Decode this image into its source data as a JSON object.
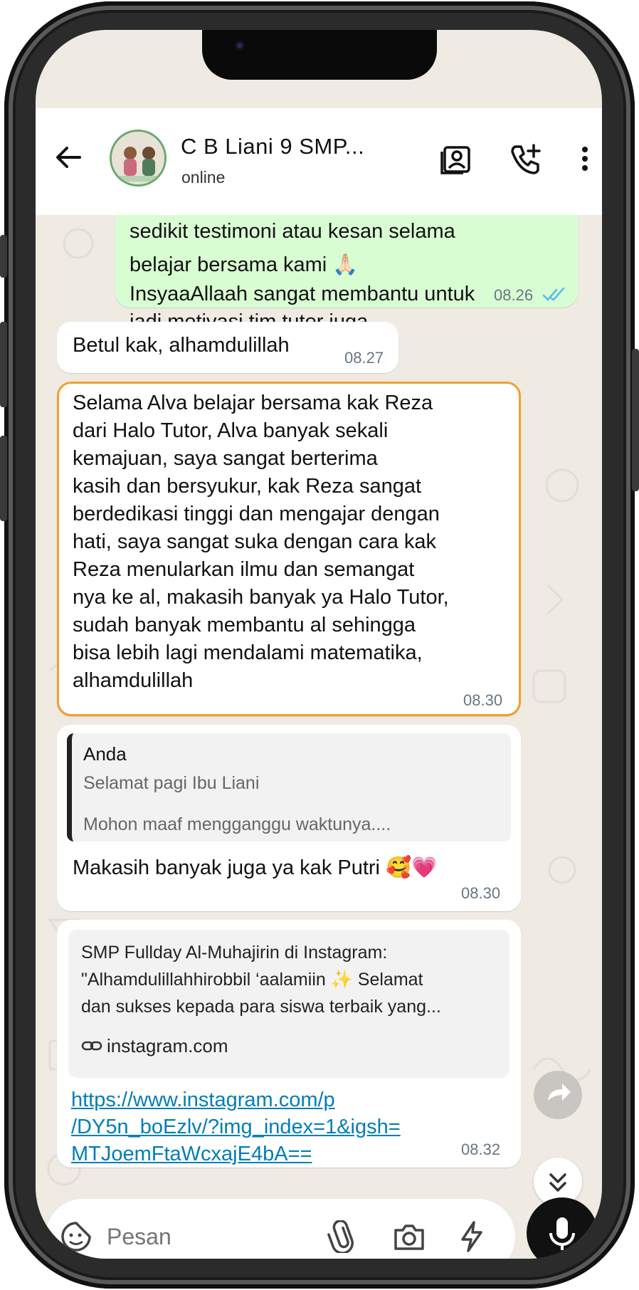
{
  "header": {
    "title": "C B Liani 9 SMP...",
    "status": "online"
  },
  "messages": {
    "m1": {
      "lines": [
        "sedikit testimoni atau kesan selama",
        "belajar bersama kami 🙏🏻",
        "InsyaaAllaah sangat membantu untuk",
        "jadi motivasi tim tutor juga"
      ],
      "time": "08.26"
    },
    "m2": {
      "text": "Betul kak, alhamdulillah",
      "time": "08.27"
    },
    "m3": {
      "lines": [
        "Selama Alva belajar bersama kak Reza",
        "dari Halo Tutor, Alva banyak sekali",
        "kemajuan, saya sangat berterima",
        "kasih dan bersyukur, kak Reza sangat",
        "berdedikasi tinggi dan mengajar dengan",
        "hati, saya sangat suka dengan cara kak",
        "Reza menularkan ilmu dan semangat",
        "nya ke al, makasih banyak ya Halo Tutor,",
        "sudah banyak membantu al sehingga",
        "bisa lebih lagi mendalami matematika,",
        "alhamdulillah"
      ],
      "time": "08.30"
    },
    "m4": {
      "quote_author": "Anda",
      "quote_line1": "Selamat pagi Ibu Liani",
      "quote_line2": "Mohon maaf mengganggu waktunya....",
      "text": "Makasih banyak juga ya kak Putri 🥰💗",
      "time": "08.30"
    },
    "m5": {
      "card_title": "SMP Fullday Al-Muhajirin di Instagram:",
      "card_desc1": "\"Alhamdulillahhirobbil ‘aalamiin ✨ Selamat",
      "card_desc2": "dan sukses kepada para siswa terbaik yang...",
      "card_domain": "instagram.com",
      "link_lines": [
        "https://www.instagram.com/p",
        "/DY5n_boEzlv/?img_index=1&igsh=",
        "MTJoemFtaWcxajE4bA=="
      ],
      "time": "08.32"
    }
  },
  "input": {
    "placeholder": "Pesan"
  },
  "icons": {
    "back": "arrow-left-icon",
    "contact": "contact-card-icon",
    "add_call": "phone-plus-icon",
    "menu": "more-vertical-icon",
    "read_receipt": "double-check-icon",
    "forward": "forward-icon",
    "scroll_down": "double-chevron-down-icon",
    "sticker": "sticker-icon",
    "attach": "paperclip-icon",
    "camera": "camera-icon",
    "quick": "lightning-icon",
    "mic": "microphone-icon"
  },
  "colors": {
    "outgoing_bubble": "#d9fdd3",
    "incoming_bubble": "#ffffff",
    "highlight_border": "#f0a030",
    "read_tick": "#53bdeb",
    "link": "#027eb5",
    "wallpaper": "#efeae2"
  }
}
